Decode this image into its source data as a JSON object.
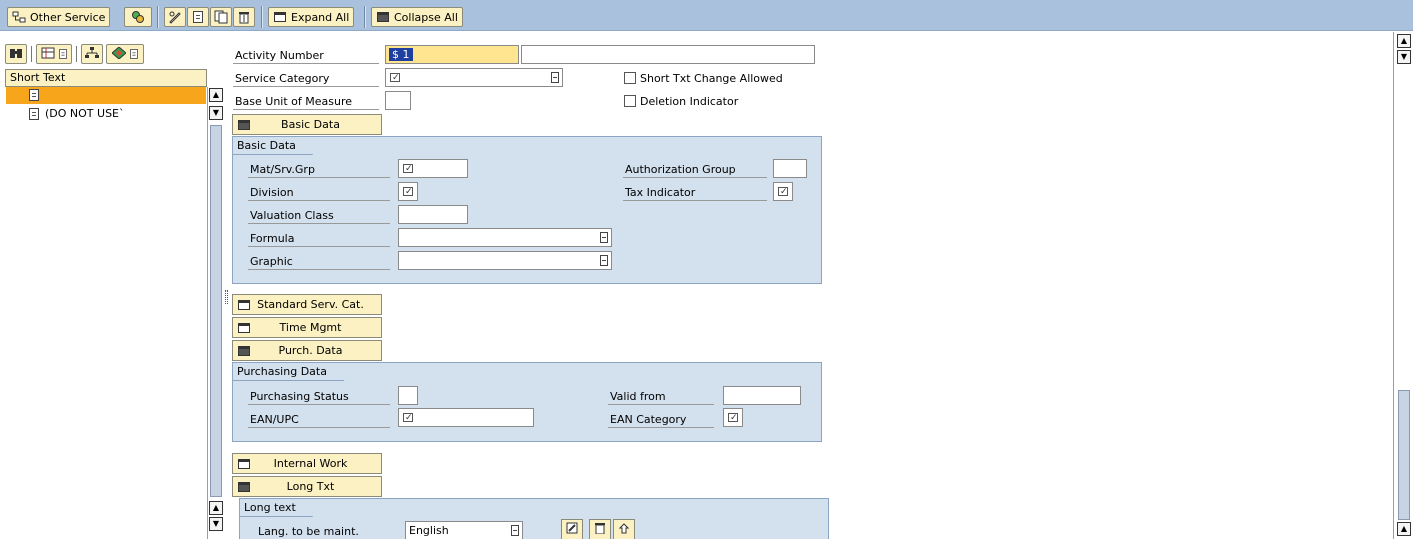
{
  "toolbar": {
    "other_service": "Other Service",
    "expand_all": "Expand All",
    "collapse_all": "Collapse All"
  },
  "left_pane": {
    "header": "Short Text",
    "tree": [
      {
        "label": ""
      },
      {
        "label": "(DO NOT USE`"
      }
    ]
  },
  "form": {
    "activity_number": {
      "label": "Activity Number",
      "value": "$ 1",
      "desc": ""
    },
    "service_category": {
      "label": "Service Category"
    },
    "short_txt_change": {
      "label": "Short Txt Change Allowed",
      "checked": false
    },
    "base_unit": {
      "label": "Base Unit of Measure",
      "value": ""
    },
    "deletion_indicator": {
      "label": "Deletion Indicator",
      "checked": false
    }
  },
  "sections": {
    "basic_data_button": "Basic Data",
    "basic_data_group": "Basic Data",
    "standard_serv_cat": "Standard Serv. Cat.",
    "time_mgmt": "Time Mgmt",
    "purch_data_button": "Purch. Data",
    "purchasing_group": "Purchasing Data",
    "internal_work": "Internal Work",
    "long_txt": "Long Txt",
    "long_text_group": "Long text"
  },
  "basic_data": {
    "mat_srv_grp": "Mat/Srv.Grp",
    "division": "Division",
    "valuation_class": "Valuation Class",
    "formula": "Formula",
    "graphic": "Graphic",
    "authorization_group": "Authorization Group",
    "tax_indicator": "Tax Indicator"
  },
  "purchasing": {
    "purchasing_status": "Purchasing Status",
    "ean_upc": "EAN/UPC",
    "valid_from": "Valid from",
    "ean_category": "EAN Category"
  },
  "long_text": {
    "lang_label": "Lang. to be maint.",
    "lang_value": "English"
  }
}
